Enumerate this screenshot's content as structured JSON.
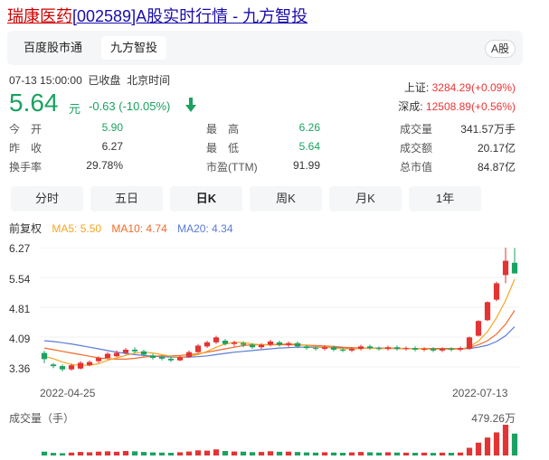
{
  "page_title": {
    "part1": "瑞康医药",
    "part2": "[002589]A股实时行情 - 九方智投"
  },
  "tabs": [
    {
      "label": "百度股市通",
      "active": false
    },
    {
      "label": "九方智投",
      "active": true
    }
  ],
  "market_badge": "A股",
  "quote": {
    "time": "07-13 15:00:00",
    "status": "已收盘",
    "zone": "北京时间",
    "price": "5.64",
    "unit": "元",
    "change": "-0.63",
    "change_pct": "(-10.05%)",
    "direction": "down"
  },
  "indices": [
    {
      "label": "上证:",
      "value": "3284.29(+0.09%)"
    },
    {
      "label": "深成:",
      "value": "12508.89(+0.56%)"
    }
  ],
  "stats": [
    [
      {
        "label": "今　开",
        "value": "5.90",
        "tone": "green"
      },
      {
        "label": "最　高",
        "value": "6.26",
        "tone": "green"
      },
      {
        "label": "成交量",
        "value": "341.57万手",
        "tone": "grey"
      }
    ],
    [
      {
        "label": "昨　收",
        "value": "6.27",
        "tone": "grey"
      },
      {
        "label": "最　低",
        "value": "5.64",
        "tone": "green"
      },
      {
        "label": "成交额",
        "value": "20.17亿",
        "tone": "grey"
      }
    ],
    [
      {
        "label": "换手率",
        "value": "29.78%",
        "tone": "grey"
      },
      {
        "label": "市盈(TTM)",
        "value": "91.99",
        "tone": "grey"
      },
      {
        "label": "总市值",
        "value": "84.87亿",
        "tone": "grey"
      }
    ]
  ],
  "period_tabs": [
    {
      "label": "分时",
      "active": false
    },
    {
      "label": "五日",
      "active": false
    },
    {
      "label": "日K",
      "active": true
    },
    {
      "label": "周K",
      "active": false
    },
    {
      "label": "月K",
      "active": false
    },
    {
      "label": "1年",
      "active": false
    }
  ],
  "legend": {
    "adjust": "前复权",
    "ma5": "MA5: 5.50",
    "ma10": "MA10: 4.74",
    "ma20": "MA20: 4.34"
  },
  "colors": {
    "up": "#e33333",
    "down": "#1aa260",
    "ma5": "#f5a623",
    "ma10": "#f06a28",
    "ma20": "#5b7bd5"
  },
  "chart_data": {
    "type": "candlestick",
    "y_ticks": [
      "6.27",
      "5.54",
      "4.81",
      "4.09",
      "3.36"
    ],
    "ylim": [
      3.36,
      6.27
    ],
    "x_ticks": [
      "2022-04-25",
      "2022-07-13"
    ],
    "candles": [
      {
        "o": 3.7,
        "c": 3.55,
        "h": 3.75,
        "l": 3.45
      },
      {
        "o": 3.42,
        "c": 3.38,
        "h": 3.46,
        "l": 3.33
      },
      {
        "o": 3.38,
        "c": 3.3,
        "h": 3.42,
        "l": 3.25
      },
      {
        "o": 3.3,
        "c": 3.4,
        "h": 3.44,
        "l": 3.27
      },
      {
        "o": 3.32,
        "c": 3.46,
        "h": 3.5,
        "l": 3.3
      },
      {
        "o": 3.4,
        "c": 3.48,
        "h": 3.52,
        "l": 3.38
      },
      {
        "o": 3.5,
        "c": 3.58,
        "h": 3.62,
        "l": 3.46
      },
      {
        "o": 3.58,
        "c": 3.68,
        "h": 3.72,
        "l": 3.55
      },
      {
        "o": 3.62,
        "c": 3.7,
        "h": 3.76,
        "l": 3.6
      },
      {
        "o": 3.7,
        "c": 3.78,
        "h": 3.82,
        "l": 3.66
      },
      {
        "o": 3.78,
        "c": 3.74,
        "h": 3.84,
        "l": 3.7
      },
      {
        "o": 3.74,
        "c": 3.66,
        "h": 3.78,
        "l": 3.62
      },
      {
        "o": 3.64,
        "c": 3.58,
        "h": 3.68,
        "l": 3.54
      },
      {
        "o": 3.6,
        "c": 3.56,
        "h": 3.64,
        "l": 3.52
      },
      {
        "o": 3.56,
        "c": 3.52,
        "h": 3.6,
        "l": 3.48
      },
      {
        "o": 3.52,
        "c": 3.6,
        "h": 3.64,
        "l": 3.5
      },
      {
        "o": 3.6,
        "c": 3.72,
        "h": 3.76,
        "l": 3.58
      },
      {
        "o": 3.72,
        "c": 3.88,
        "h": 3.92,
        "l": 3.7
      },
      {
        "o": 3.86,
        "c": 3.96,
        "h": 4.0,
        "l": 3.82
      },
      {
        "o": 3.96,
        "c": 4.08,
        "h": 4.12,
        "l": 3.92
      },
      {
        "o": 4.0,
        "c": 3.92,
        "h": 4.04,
        "l": 3.88
      },
      {
        "o": 3.92,
        "c": 3.96,
        "h": 4.0,
        "l": 3.86
      },
      {
        "o": 3.94,
        "c": 3.9,
        "h": 3.98,
        "l": 3.84
      },
      {
        "o": 3.9,
        "c": 3.84,
        "h": 3.94,
        "l": 3.8
      },
      {
        "o": 3.84,
        "c": 3.9,
        "h": 3.94,
        "l": 3.8
      },
      {
        "o": 3.9,
        "c": 3.98,
        "h": 4.02,
        "l": 3.86
      },
      {
        "o": 3.96,
        "c": 3.9,
        "h": 4.0,
        "l": 3.86
      },
      {
        "o": 3.9,
        "c": 3.94,
        "h": 3.98,
        "l": 3.84
      },
      {
        "o": 3.94,
        "c": 3.86,
        "h": 3.98,
        "l": 3.82
      },
      {
        "o": 3.86,
        "c": 3.82,
        "h": 3.9,
        "l": 3.78
      },
      {
        "o": 3.82,
        "c": 3.8,
        "h": 3.86,
        "l": 3.76
      },
      {
        "o": 3.8,
        "c": 3.84,
        "h": 3.88,
        "l": 3.76
      },
      {
        "o": 3.84,
        "c": 3.78,
        "h": 3.88,
        "l": 3.74
      },
      {
        "o": 3.78,
        "c": 3.76,
        "h": 3.82,
        "l": 3.72
      },
      {
        "o": 3.76,
        "c": 3.8,
        "h": 3.84,
        "l": 3.72
      },
      {
        "o": 3.8,
        "c": 3.86,
        "h": 3.9,
        "l": 3.76
      },
      {
        "o": 3.86,
        "c": 3.82,
        "h": 3.9,
        "l": 3.78
      },
      {
        "o": 3.82,
        "c": 3.8,
        "h": 3.86,
        "l": 3.76
      },
      {
        "o": 3.8,
        "c": 3.84,
        "h": 3.88,
        "l": 3.76
      },
      {
        "o": 3.84,
        "c": 3.8,
        "h": 3.88,
        "l": 3.76
      },
      {
        "o": 3.8,
        "c": 3.82,
        "h": 3.86,
        "l": 3.76
      },
      {
        "o": 3.82,
        "c": 3.78,
        "h": 3.86,
        "l": 3.74
      },
      {
        "o": 3.78,
        "c": 3.8,
        "h": 3.84,
        "l": 3.74
      },
      {
        "o": 3.8,
        "c": 3.76,
        "h": 3.84,
        "l": 3.72
      },
      {
        "o": 3.76,
        "c": 3.8,
        "h": 3.84,
        "l": 3.72
      },
      {
        "o": 3.8,
        "c": 3.78,
        "h": 3.84,
        "l": 3.74
      },
      {
        "o": 3.78,
        "c": 3.82,
        "h": 3.86,
        "l": 3.74
      },
      {
        "o": 3.8,
        "c": 4.08,
        "h": 4.1,
        "l": 3.78
      },
      {
        "o": 4.12,
        "c": 4.48,
        "h": 4.5,
        "l": 4.1
      },
      {
        "o": 4.5,
        "c": 4.94,
        "h": 4.96,
        "l": 4.48
      },
      {
        "o": 5.0,
        "c": 5.4,
        "h": 5.44,
        "l": 4.96
      },
      {
        "o": 5.6,
        "c": 5.95,
        "h": 6.27,
        "l": 5.4
      },
      {
        "o": 5.9,
        "c": 5.64,
        "h": 6.26,
        "l": 5.64
      }
    ],
    "ma5": [
      3.62,
      3.56,
      3.48,
      3.42,
      3.4,
      3.4,
      3.44,
      3.52,
      3.58,
      3.64,
      3.7,
      3.72,
      3.7,
      3.66,
      3.62,
      3.6,
      3.62,
      3.66,
      3.74,
      3.84,
      3.92,
      3.96,
      3.96,
      3.92,
      3.9,
      3.9,
      3.92,
      3.92,
      3.92,
      3.88,
      3.86,
      3.84,
      3.82,
      3.8,
      3.8,
      3.81,
      3.82,
      3.81,
      3.82,
      3.82,
      3.81,
      3.81,
      3.8,
      3.79,
      3.79,
      3.79,
      3.79,
      3.85,
      3.99,
      4.22,
      4.56,
      4.98,
      5.5
    ],
    "ma10": [
      3.82,
      3.78,
      3.74,
      3.7,
      3.66,
      3.62,
      3.58,
      3.56,
      3.55,
      3.55,
      3.57,
      3.6,
      3.62,
      3.63,
      3.63,
      3.64,
      3.66,
      3.68,
      3.72,
      3.76,
      3.8,
      3.84,
      3.88,
      3.9,
      3.9,
      3.9,
      3.9,
      3.9,
      3.9,
      3.89,
      3.88,
      3.87,
      3.86,
      3.84,
      3.83,
      3.82,
      3.82,
      3.81,
      3.81,
      3.81,
      3.81,
      3.81,
      3.81,
      3.8,
      3.8,
      3.8,
      3.8,
      3.83,
      3.9,
      4.0,
      4.16,
      4.4,
      4.74
    ],
    "ma20": [
      4.0,
      3.98,
      3.95,
      3.92,
      3.88,
      3.84,
      3.8,
      3.76,
      3.72,
      3.69,
      3.66,
      3.64,
      3.62,
      3.61,
      3.6,
      3.6,
      3.6,
      3.61,
      3.63,
      3.66,
      3.69,
      3.72,
      3.74,
      3.76,
      3.78,
      3.8,
      3.82,
      3.83,
      3.84,
      3.84,
      3.84,
      3.84,
      3.83,
      3.83,
      3.82,
      3.82,
      3.82,
      3.82,
      3.82,
      3.81,
      3.81,
      3.81,
      3.81,
      3.81,
      3.81,
      3.81,
      3.8,
      3.81,
      3.84,
      3.89,
      3.98,
      4.12,
      4.34
    ],
    "volume_label": "成交量（手）",
    "volume_max": "479.26万",
    "volume_max_value": 479.26,
    "volumes": [
      60,
      40,
      35,
      45,
      55,
      50,
      60,
      65,
      58,
      70,
      65,
      55,
      48,
      45,
      42,
      50,
      62,
      80,
      75,
      95,
      70,
      62,
      60,
      52,
      55,
      66,
      58,
      60,
      54,
      48,
      45,
      50,
      46,
      42,
      48,
      55,
      50,
      45,
      50,
      46,
      44,
      42,
      44,
      40,
      44,
      42,
      46,
      120,
      200,
      280,
      360,
      479.26,
      341.57
    ]
  }
}
